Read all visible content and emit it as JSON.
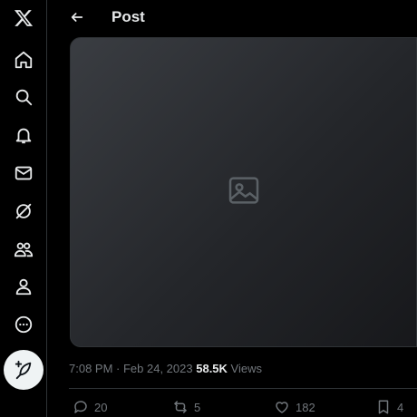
{
  "header": {
    "title": "Post"
  },
  "sidebar": {
    "items": [
      {
        "icon": "x-logo-icon"
      },
      {
        "icon": "home-icon"
      },
      {
        "icon": "search-icon"
      },
      {
        "icon": "notifications-bell-icon"
      },
      {
        "icon": "messages-envelope-icon"
      },
      {
        "icon": "grok-icon"
      },
      {
        "icon": "communities-icon"
      },
      {
        "icon": "profile-icon"
      },
      {
        "icon": "more-icon"
      },
      {
        "icon": "compose-post-icon"
      }
    ]
  },
  "post": {
    "time": "7:08 PM",
    "separator": " · ",
    "date": "Feb 24, 2023",
    "views_count": "58.5K",
    "views_label": " Views"
  },
  "actions": {
    "replies": "20",
    "reposts": "5",
    "likes": "182",
    "bookmarks": "4"
  },
  "colors": {
    "background": "#000000",
    "text": "#e7e9ea",
    "muted": "#71767b",
    "border": "#2f3336"
  }
}
